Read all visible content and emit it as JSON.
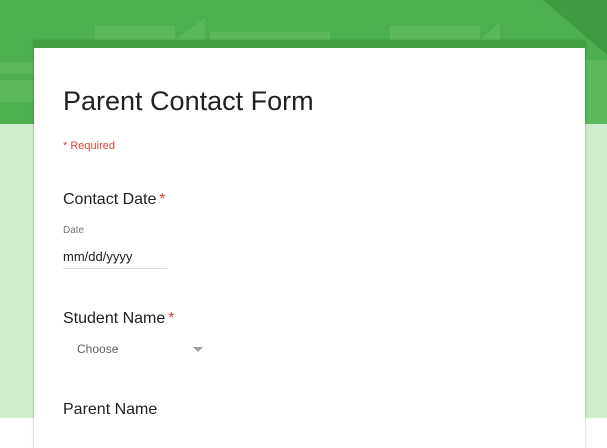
{
  "form": {
    "title": "Parent Contact Form",
    "required_note": "* Required"
  },
  "questions": [
    {
      "title": "Contact Date",
      "required": true,
      "required_mark": "*",
      "sublabel": "Date",
      "input_placeholder": "mm/dd/yyyy"
    },
    {
      "title": "Student Name",
      "required": true,
      "required_mark": "*",
      "dropdown_value": "Choose"
    },
    {
      "title": "Parent Name",
      "required": false
    }
  ],
  "colors": {
    "header": "#4caf50",
    "header_dark": "#43a047",
    "page_background": "#d1ebcd",
    "required": "#db4437",
    "text": "#202124"
  },
  "icons": {
    "dropdown": "dropdown-arrow-icon"
  }
}
